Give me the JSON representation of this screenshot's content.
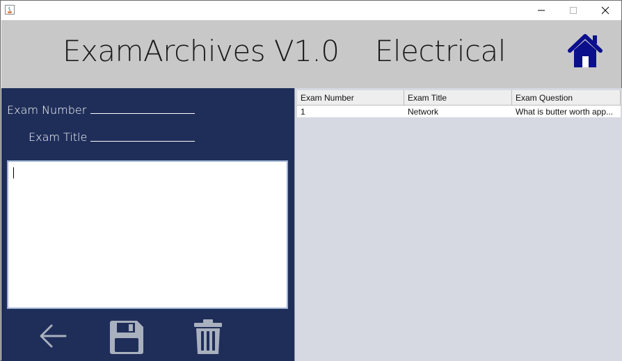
{
  "window": {
    "controls": [
      "minimize",
      "maximize",
      "close"
    ]
  },
  "header": {
    "title": "ExamArchives V1.0    Electrical",
    "home_icon": "home-icon"
  },
  "form": {
    "exam_number_label": "Exam Number",
    "exam_number_value": "",
    "exam_title_label": "Exam Title",
    "exam_title_value": "",
    "question_text": ""
  },
  "toolbar": {
    "back_icon": "arrow-left-icon",
    "save_icon": "floppy-disk-icon",
    "delete_icon": "trash-icon"
  },
  "table": {
    "columns": [
      "Exam Number",
      "Exam Title",
      "Exam Question"
    ],
    "rows": [
      [
        "1",
        "Network",
        "What is butter worth app..."
      ]
    ]
  },
  "colors": {
    "header_bg": "#c8c8c8",
    "panel_navy": "#1f2e59",
    "home_icon": "#0b0f8c",
    "table_bg": "#d6d9e1"
  }
}
